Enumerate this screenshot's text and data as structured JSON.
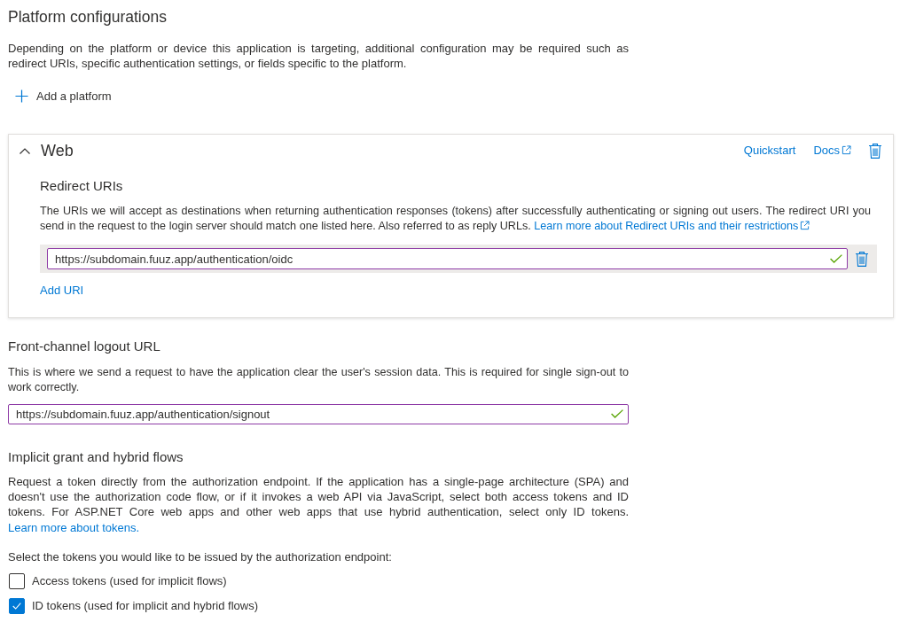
{
  "platform_configurations": {
    "title": "Platform configurations",
    "description": "Depending on the platform or device this application is targeting, additional configuration may be required such as redirect URIs, specific authentication settings, or fields specific to the platform.",
    "add_button": "Add a platform"
  },
  "web_card": {
    "title": "Web",
    "expanded": true,
    "links": [
      {
        "label": "Quickstart",
        "external": false
      },
      {
        "label": "Docs",
        "external": true
      }
    ],
    "redirect_uris": {
      "title": "Redirect URIs",
      "description": "The URIs we will accept as destinations when returning authentication responses (tokens) after successfully authenticating or signing out users. The redirect URI you send in the request to the login server should match one listed here. Also referred to as reply URLs.",
      "link": {
        "label": "Learn more about Redirect URIs and their restrictions",
        "external": true
      },
      "uris": [
        {
          "value": "https://subdomain.fuuz.app/authentication/oidc",
          "valid": true
        }
      ],
      "add_button": "Add URI"
    }
  },
  "front_channel_logout": {
    "title": "Front-channel logout URL",
    "description": "This is where we send a request to have the application clear the user's session data. This is required for single sign-out to work correctly.",
    "field": {
      "value": "https://subdomain.fuuz.app/authentication/signout",
      "valid": true
    }
  },
  "implicit_grant": {
    "title": "Implicit grant and hybrid flows",
    "description": "Request a token directly from the authorization endpoint. If the application has a single-page architecture (SPA) and doesn't use the authorization code flow, or if it invokes a web API via JavaScript, select both access tokens and ID tokens. For ASP.NET Core web apps and other web apps that use hybrid authentication, select only ID tokens.",
    "link": {
      "label": "Learn more about tokens.",
      "external": false
    },
    "prompt": "Select the tokens you would like to be issued by the authorization endpoint:",
    "tokens": [
      {
        "label": "Access tokens (used for implicit flows)",
        "checked": false
      },
      {
        "label": "ID tokens (used for implicit and hybrid flows)",
        "checked": true
      }
    ]
  }
}
